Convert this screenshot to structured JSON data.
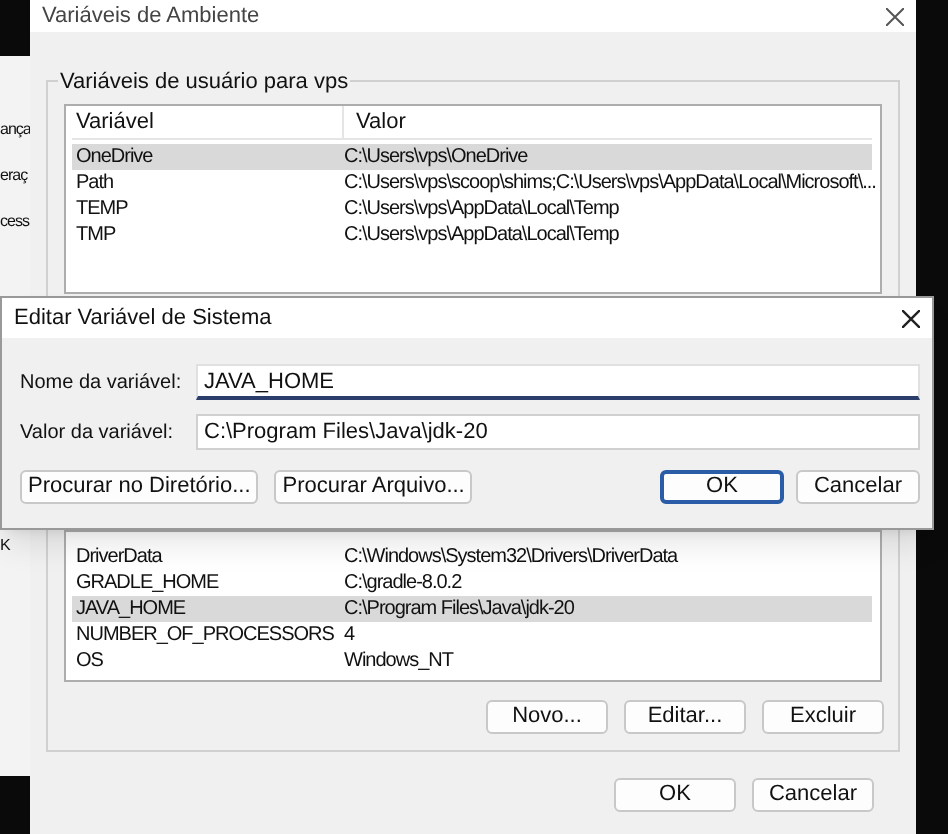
{
  "background_window": {
    "texts": [
      "ança",
      "eraç",
      "cess",
      "K"
    ]
  },
  "window": {
    "title": "Variáveis de Ambiente"
  },
  "user_variables": {
    "title": "Variáveis de usuário para vps",
    "columns": [
      "Variável",
      "Valor"
    ],
    "rows": [
      {
        "name": "OneDrive",
        "value": "C:\\Users\\vps\\OneDrive",
        "selected": true
      },
      {
        "name": "Path",
        "value": "C:\\Users\\vps\\scoop\\shims;C:\\Users\\vps\\AppData\\Local\\Microsoft\\...",
        "selected": false
      },
      {
        "name": "TEMP",
        "value": "C:\\Users\\vps\\AppData\\Local\\Temp",
        "selected": false
      },
      {
        "name": "TMP",
        "value": "C:\\Users\\vps\\AppData\\Local\\Temp",
        "selected": false
      }
    ]
  },
  "system_variables": {
    "rows": [
      {
        "name": "DriverData",
        "value": "C:\\Windows\\System32\\Drivers\\DriverData",
        "selected": false
      },
      {
        "name": "GRADLE_HOME",
        "value": "C:\\gradle-8.0.2",
        "selected": false
      },
      {
        "name": "JAVA_HOME",
        "value": "C:\\Program Files\\Java\\jdk-20",
        "selected": true
      },
      {
        "name": "NUMBER_OF_PROCESSORS",
        "value": "4",
        "selected": false
      },
      {
        "name": "OS",
        "value": "Windows_NT",
        "selected": false
      }
    ],
    "buttons": [
      "Novo...",
      "Editar...",
      "Excluir"
    ]
  },
  "buttons": [
    "OK",
    "Cancelar"
  ],
  "dialog": {
    "title": "Editar Variável de Sistema",
    "fields": [
      {
        "label": "Nome da variável:",
        "value": "JAVA_HOME",
        "focused": true
      },
      {
        "label": "Valor da variável:",
        "value": "C:\\Program Files\\Java\\jdk-20",
        "focused": false
      }
    ],
    "left_buttons": [
      {
        "label": "Procurar no Diretório...",
        "default": false
      },
      {
        "label": "Procurar Arquivo...",
        "default": false
      }
    ],
    "right_buttons": [
      {
        "label": "OK",
        "default": true
      },
      {
        "label": "Cancelar",
        "default": false
      }
    ]
  }
}
